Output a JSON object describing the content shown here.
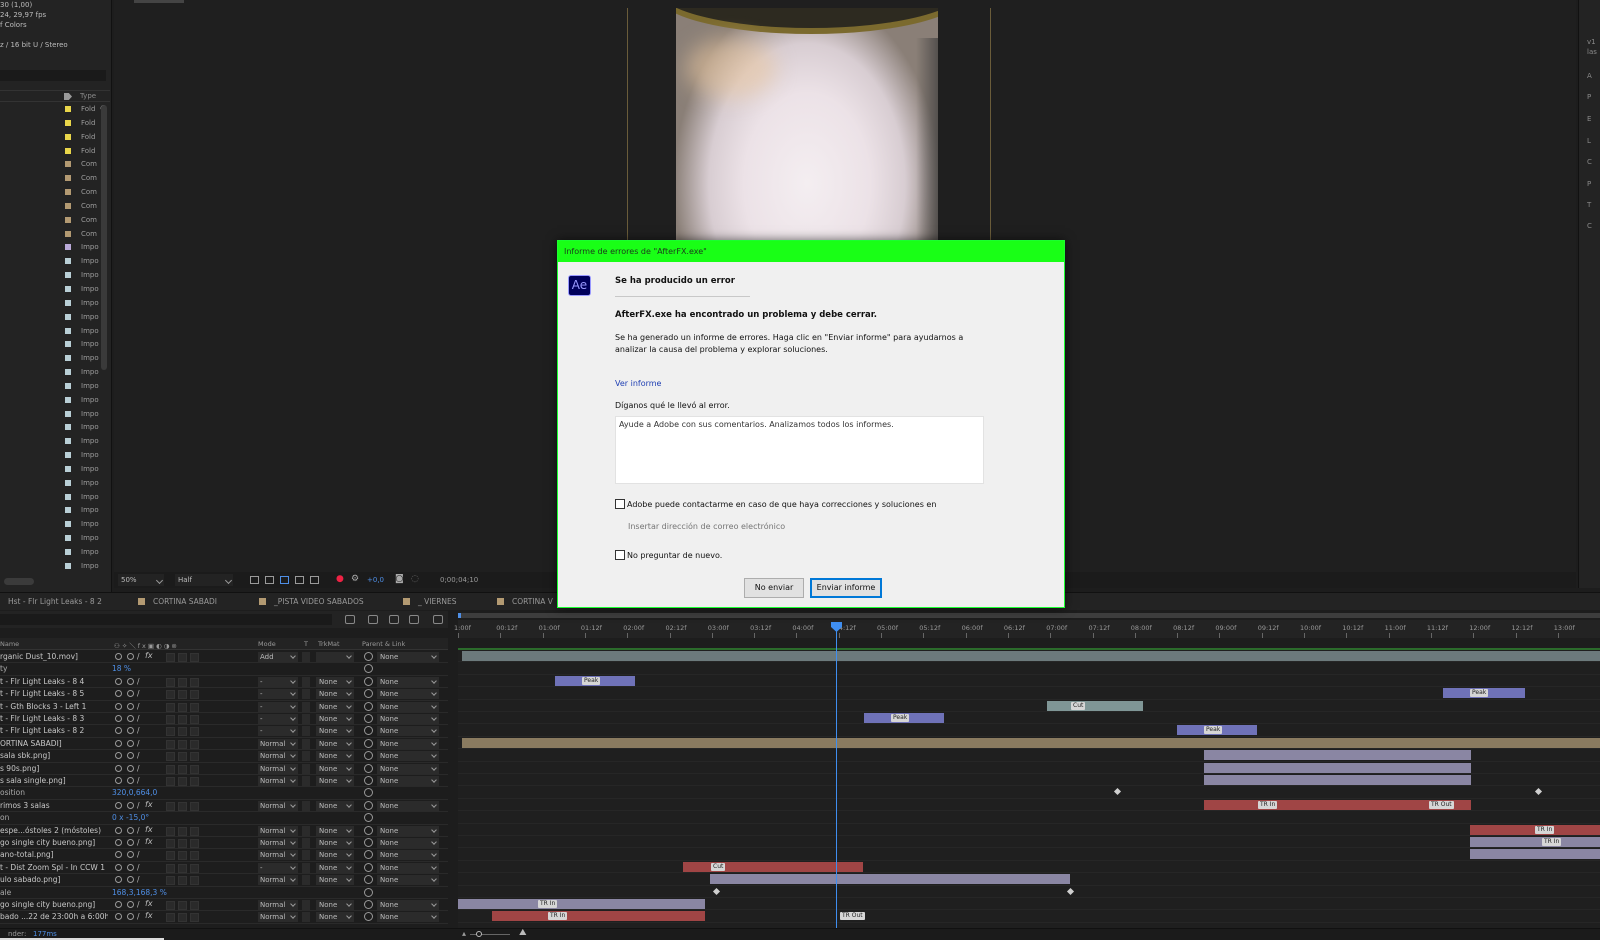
{
  "project": {
    "info": [
      "30 (1,00)",
      "24, 29,97 fps",
      "f Colors",
      "z / 16 bit U / Stereo"
    ],
    "type_header": "Type",
    "items": [
      {
        "type": "Fold",
        "color": "#e9d64a"
      },
      {
        "type": "Fold",
        "color": "#e9d64a"
      },
      {
        "type": "Fold",
        "color": "#e9d64a"
      },
      {
        "type": "Fold",
        "color": "#e9d64a"
      },
      {
        "type": "Com",
        "color": "#b39a72"
      },
      {
        "type": "Com",
        "color": "#b39a72"
      },
      {
        "type": "Com",
        "color": "#b39a72"
      },
      {
        "type": "Com",
        "color": "#b39a72"
      },
      {
        "type": "Com",
        "color": "#b39a72"
      },
      {
        "type": "Com",
        "color": "#b39a72"
      },
      {
        "type": "Impo",
        "color": "#b9a9d8"
      },
      {
        "type": "Impo",
        "color": "#b9cfd6"
      },
      {
        "type": "Impo",
        "color": "#b9cfd6"
      },
      {
        "type": "Impo",
        "color": "#b9cfd6"
      },
      {
        "type": "Impo",
        "color": "#b9cfd6"
      },
      {
        "type": "Impo",
        "color": "#b9cfd6"
      },
      {
        "type": "Impo",
        "color": "#b9cfd6"
      },
      {
        "type": "Impo",
        "color": "#b9cfd6"
      },
      {
        "type": "Impo",
        "color": "#b9cfd6"
      },
      {
        "type": "Impo",
        "color": "#b9cfd6"
      },
      {
        "type": "Impo",
        "color": "#b9cfd6"
      },
      {
        "type": "Impo",
        "color": "#b9cfd6"
      },
      {
        "type": "Impo",
        "color": "#b9cfd6"
      },
      {
        "type": "Impo",
        "color": "#b9cfd6"
      },
      {
        "type": "Impo",
        "color": "#b9cfd6"
      },
      {
        "type": "Impo",
        "color": "#b9cfd6"
      },
      {
        "type": "Impo",
        "color": "#b9cfd6"
      },
      {
        "type": "Impo",
        "color": "#b9cfd6"
      },
      {
        "type": "Impo",
        "color": "#b9cfd6"
      },
      {
        "type": "Impo",
        "color": "#b9cfd6"
      },
      {
        "type": "Impo",
        "color": "#b9cfd6"
      },
      {
        "type": "Impo",
        "color": "#b9cfd6"
      },
      {
        "type": "Impo",
        "color": "#b9cfd6"
      },
      {
        "type": "Impo",
        "color": "#b9cfd6"
      }
    ]
  },
  "viewer": {
    "zoom": "50%",
    "resolution": "Half",
    "exposure": "+0,0",
    "timecode": "0;00;04;10"
  },
  "rightstrip": [
    "v1",
    "las",
    "A",
    "P",
    "E",
    "L",
    "C",
    "P",
    "T",
    "C"
  ],
  "timeline": {
    "tabs": [
      {
        "label": "Hst - Flr Light Leaks - 8 2",
        "active": true
      },
      {
        "label": "CORTINA SABADI",
        "active": false
      },
      {
        "label": "_PISTA VIDEO SABADOS",
        "active": false
      },
      {
        "label": "_ VIERNES",
        "active": false
      },
      {
        "label": "CORTINA V",
        "active": false
      }
    ],
    "columns": {
      "name": "Name",
      "mode": "Mode",
      "t": "T",
      "trkmat": "TrkMat",
      "parent": "Parent & Link"
    },
    "ruler": [
      "1:00f",
      "00:12f",
      "01:00f",
      "01:12f",
      "02:00f",
      "02:12f",
      "03:00f",
      "03:12f",
      "04:00f",
      "04:12f",
      "05:00f",
      "05:12f",
      "06:00f",
      "06:12f",
      "07:00f",
      "07:12f",
      "08:00f",
      "08:12f",
      "09:00f",
      "09:12f",
      "10:00f",
      "10:12f",
      "11:00f",
      "11:12f",
      "12:00f",
      "12:12f",
      "13:00f"
    ],
    "rows": [
      {
        "name": "rganic Dust_10.mov]",
        "mode": "Add",
        "trk": "",
        "parent": "None",
        "kind": "layer",
        "fx": true
      },
      {
        "name": "ty",
        "value": "18 %",
        "kind": "prop"
      },
      {
        "name": "t - Flr Light Leaks - 8 4",
        "mode": "-",
        "trk": "None",
        "parent": "None",
        "kind": "layer"
      },
      {
        "name": "t - Flr Light Leaks - 8 5",
        "mode": "-",
        "trk": "None",
        "parent": "None",
        "kind": "layer"
      },
      {
        "name": "t - Gth Blocks 3 - Left 1",
        "mode": "-",
        "trk": "None",
        "parent": "None",
        "kind": "layer"
      },
      {
        "name": "t - Flr Light Leaks - 8 3",
        "mode": "-",
        "trk": "None",
        "parent": "None",
        "kind": "layer"
      },
      {
        "name": "t - Flr Light Leaks - 8 2",
        "mode": "-",
        "trk": "None",
        "parent": "None",
        "kind": "layer"
      },
      {
        "name": "ORTINA SABADI]",
        "mode": "Normal",
        "trk": "None",
        "parent": "None",
        "kind": "layer"
      },
      {
        "name": "sala sbk.png]",
        "mode": "Normal",
        "trk": "None",
        "parent": "None",
        "kind": "layer"
      },
      {
        "name": "s 90s.png]",
        "mode": "Normal",
        "trk": "None",
        "parent": "None",
        "kind": "layer"
      },
      {
        "name": "s sala single.png]",
        "mode": "Normal",
        "trk": "None",
        "parent": "None",
        "kind": "layer"
      },
      {
        "name": "osition",
        "value": "320,0,664,0",
        "kind": "prop"
      },
      {
        "name": "rimos 3 salas",
        "mode": "Normal",
        "trk": "None",
        "parent": "None",
        "kind": "layer",
        "fx": true
      },
      {
        "name": "on",
        "value": "0 x -15,0°",
        "kind": "prop"
      },
      {
        "name": "espe...óstoles 2 (móstoles)",
        "mode": "Normal",
        "trk": "None",
        "parent": "None",
        "kind": "layer",
        "fx": true
      },
      {
        "name": "go single city bueno.png]",
        "mode": "Normal",
        "trk": "None",
        "parent": "None",
        "kind": "layer",
        "fx": true
      },
      {
        "name": "ano-total.png]",
        "mode": "Normal",
        "trk": "None",
        "parent": "None",
        "kind": "layer"
      },
      {
        "name": "t - Dist Zoom Spl - In CCW 1",
        "mode": "-",
        "trk": "None",
        "parent": "None",
        "kind": "layer"
      },
      {
        "name": "ulo sabado.png]",
        "mode": "Normal",
        "trk": "None",
        "parent": "None",
        "kind": "layer"
      },
      {
        "name": "ale",
        "value": "168,3,168,3 %",
        "kind": "prop"
      },
      {
        "name": "go single city bueno.png]",
        "mode": "Normal",
        "trk": "None",
        "parent": "None",
        "kind": "layer",
        "fx": true
      },
      {
        "name": "bado ...22 de 23:00h a 6:00h",
        "mode": "Normal",
        "trk": "None",
        "parent": "None",
        "kind": "layer",
        "fx": true
      }
    ],
    "markers": {
      "peak": "Peak",
      "cut": "Cut",
      "trin": "TR In",
      "trout": "TR Out"
    }
  },
  "status": {
    "label": "Frame Render Time:",
    "short_label": "nder:",
    "value": "177ms"
  },
  "dialog": {
    "title": "Informe de errores de \"AfterFX.exe\"",
    "logo": "Ae",
    "heading": "Se ha producido un error",
    "bold": "AfterFX.exe ha encontrado un problema y debe cerrar.",
    "desc": "Se ha generado un informe de errores. Haga clic en \"Enviar informe\" para ayudarnos a analizar la causa del problema y explorar soluciones.",
    "link": "Ver informe",
    "ask": "Díganos qué le llevó al error.",
    "feedback": "Ayude a Adobe con sus comentarios. Analizamos todos los informes.",
    "contact_label": "Adobe puede contactarme en caso de que haya correcciones y soluciones en",
    "email_placeholder": "Insertar dirección de correo electrónico",
    "no_ask_label": "No preguntar de nuevo.",
    "btn_dont_send": "No enviar",
    "btn_send": "Enviar informe"
  },
  "colors": {
    "accent": "#3f8ef0",
    "dialog_title": "#19ff16"
  }
}
